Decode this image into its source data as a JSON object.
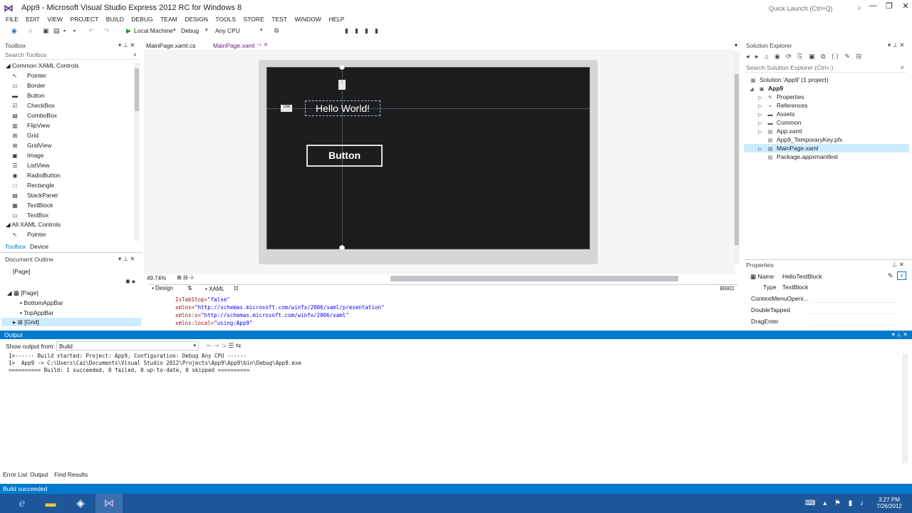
{
  "window": {
    "title": "App9 - Microsoft Visual Studio Express 2012 RC for Windows 8"
  },
  "quick_launch": {
    "placeholder": "Quick Launch (Ctrl+Q)"
  },
  "menu": [
    "FILE",
    "EDIT",
    "VIEW",
    "PROJECT",
    "BUILD",
    "DEBUG",
    "TEAM",
    "DESIGN",
    "TOOLS",
    "STORE",
    "TEST",
    "WINDOW",
    "HELP"
  ],
  "toolbar": {
    "target": "Local Machine",
    "config": "Debug",
    "platform": "Any CPU"
  },
  "toolbox": {
    "title": "Toolbox",
    "search_placeholder": "Search Toolbox",
    "section_common": "Common XAML Controls",
    "items": [
      {
        "label": "Pointer",
        "icon": "pointer-icon"
      },
      {
        "label": "Border",
        "icon": "border-icon"
      },
      {
        "label": "Button",
        "icon": "button-icon"
      },
      {
        "label": "CheckBox",
        "icon": "checkbox-icon"
      },
      {
        "label": "ComboBox",
        "icon": "combobox-icon"
      },
      {
        "label": "FlipView",
        "icon": "flipview-icon"
      },
      {
        "label": "Grid",
        "icon": "grid-icon"
      },
      {
        "label": "GridView",
        "icon": "gridview-icon"
      },
      {
        "label": "Image",
        "icon": "image-icon"
      },
      {
        "label": "ListView",
        "icon": "listview-icon"
      },
      {
        "label": "RadioButton",
        "icon": "radiobutton-icon"
      },
      {
        "label": "Rectangle",
        "icon": "rectangle-icon"
      },
      {
        "label": "StackPanel",
        "icon": "stackpanel-icon"
      },
      {
        "label": "TextBlock",
        "icon": "textblock-icon"
      },
      {
        "label": "TextBox",
        "icon": "textbox-icon"
      }
    ],
    "section_all": "All XAML Controls",
    "all_first": "Pointer",
    "tabs": [
      "Toolbox",
      "Device"
    ]
  },
  "outline": {
    "title": "Document Outline",
    "root": "[Page]",
    "items": [
      "[Page]",
      "BottomAppBar",
      "TopAppBar",
      "[Grid]"
    ]
  },
  "tabs": [
    {
      "label": "MainPage.xaml.cs"
    },
    {
      "label": "MainPage.xaml"
    }
  ],
  "designer": {
    "hello": "Hello World!",
    "button": "Button",
    "margin_left": "168",
    "zoom": "49.74%",
    "view_tabs": [
      "Design",
      "XAML"
    ]
  },
  "xaml_lines": [
    {
      "attr": "IsTabStop=",
      "val": "\"false\""
    },
    {
      "attr": "xmlns=",
      "val": "\"http://schemas.microsoft.com/winfx/2006/xaml/presentation\""
    },
    {
      "attr": "xmlns:x=",
      "val": "\"http://schemas.microsoft.com/winfx/2006/xaml\""
    },
    {
      "attr": "xmlns:local=",
      "val": "\"using:App9\""
    }
  ],
  "solution": {
    "title": "Solution Explorer",
    "search_placeholder": "Search Solution Explorer (Ctrl+;)",
    "root": "Solution 'App9' (1 project)",
    "project": "App9",
    "items": [
      "Properties",
      "References",
      "Assets",
      "Common",
      "App.xaml",
      "App9_TemporaryKey.pfx",
      "MainPage.xaml",
      "Package.appxmanifest"
    ]
  },
  "properties": {
    "title": "Properties",
    "name_label": "Name",
    "name_value": "HelloTextBlock",
    "type_label": "Type",
    "type_value": "TextBlock",
    "events": [
      "ContextMenuOpeni...",
      "DoubleTapped",
      "DragEnter"
    ]
  },
  "output": {
    "title": "Output",
    "show_from_label": "Show output from:",
    "show_from_value": "Build",
    "lines": [
      "1>------ Build started: Project: App9, Configuration: Debug Any CPU ------",
      "1>  App9 -> C:\\Users\\Caz\\Documents\\Visual Studio 2012\\Projects\\App9\\App9\\bin\\Debug\\App9.exe",
      "========== Build: 1 succeeded, 0 failed, 0 up-to-date, 0 skipped =========="
    ],
    "bottom_tabs": [
      "Error List",
      "Output",
      "Find Results"
    ]
  },
  "status": {
    "text": "Build succeeded"
  },
  "clock": {
    "time": "3:27 PM",
    "date": "7/26/2012"
  },
  "colors": {
    "accent": "#007acc",
    "canvas": "#1d1d1d",
    "vs_logo": "#68217a"
  }
}
